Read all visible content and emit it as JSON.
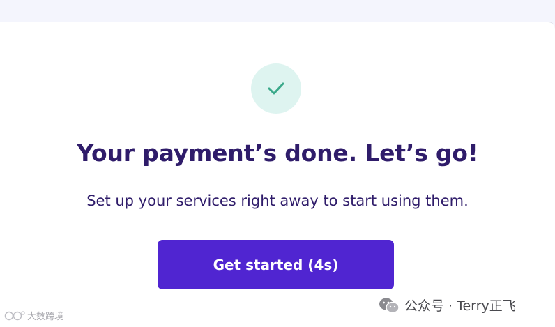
{
  "modal": {
    "title": "Your payment’s done. Let’s go!",
    "subtitle": "Set up your services right away to start using them.",
    "cta_label": "Get started (4s)"
  },
  "icons": {
    "success": "check-icon"
  },
  "watermarks": {
    "left": "大数跨境",
    "right": "公众号 · Terry正飞"
  },
  "colors": {
    "accent": "#5025d1",
    "heading": "#2f1c6a",
    "success_bg": "#def4f0",
    "success_check": "#3aa98a",
    "page_bg": "#f4f5fd"
  }
}
